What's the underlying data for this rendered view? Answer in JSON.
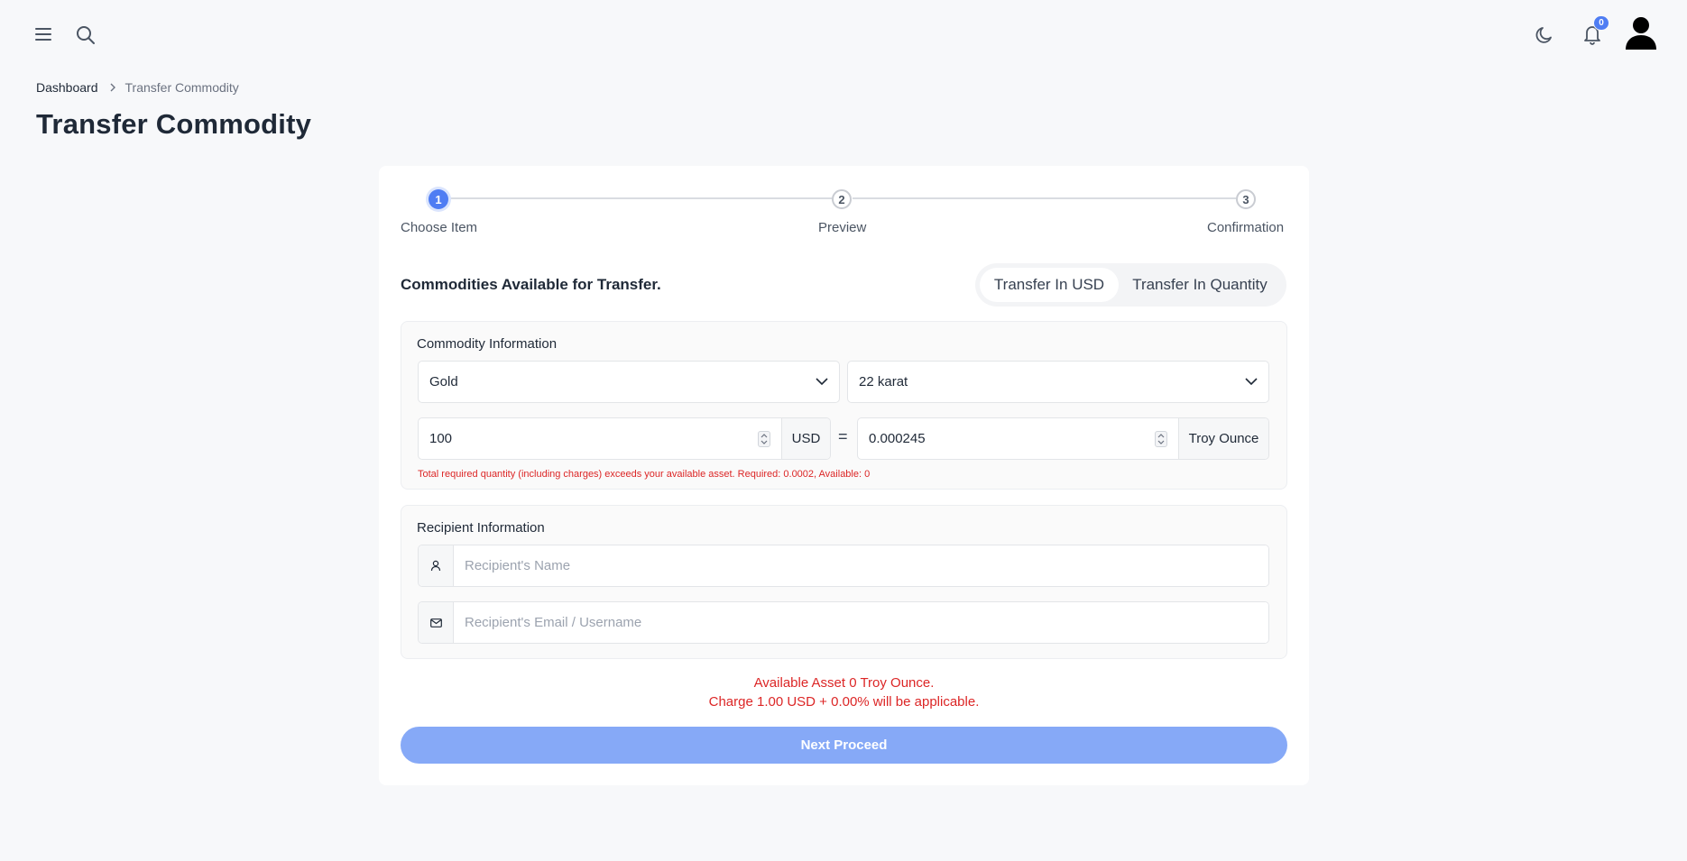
{
  "topbar": {
    "icons": [
      "menu-icon",
      "search-icon",
      "moon-icon",
      "bell-icon",
      "user-icon"
    ],
    "notification_count": "0"
  },
  "breadcrumb": {
    "home": "Dashboard",
    "current": "Transfer Commodity"
  },
  "page_title": "Transfer Commodity",
  "stepper": {
    "steps": [
      {
        "number": "1",
        "label": "Choose Item",
        "active": true
      },
      {
        "number": "2",
        "label": "Preview",
        "active": false
      },
      {
        "number": "3",
        "label": "Confirmation",
        "active": false
      }
    ]
  },
  "section_heading": "Commodities Available for Transfer.",
  "toggle": {
    "usd_label": "Transfer In USD",
    "quantity_label": "Transfer In Quantity",
    "selected": "Transfer In USD"
  },
  "commodity": {
    "label": "Commodity Information",
    "commodity_select": "Gold",
    "purity_select": "22 karat",
    "amount_value": "100",
    "amount_unit": "USD",
    "equals": "=",
    "quantity_value": "0.000245",
    "quantity_unit": "Troy Ounce",
    "error": "Total required quantity (including charges) exceeds your available asset. Required: 0.0002, Available: 0"
  },
  "recipient": {
    "label": "Recipient Information",
    "name_placeholder": "Recipient's Name",
    "email_placeholder": "Recipient's Email / Username"
  },
  "notices": {
    "available": "Available Asset 0 Troy Ounce.",
    "charge": "Charge 1.00 USD + 0.00% will be applicable."
  },
  "proceed_label": "Next Proceed",
  "colors": {
    "accent": "#4f7df3",
    "button_disabled": "#86a9f7",
    "error": "#dc2626"
  }
}
